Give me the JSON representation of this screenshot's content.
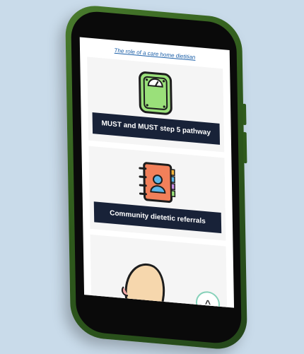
{
  "page": {
    "top_link": "The role of a care home dietitian",
    "cards": [
      {
        "label": "MUST and MUST step 5 pathway",
        "icon": "weighing-scale-icon"
      },
      {
        "label": "Community dietetic referrals",
        "icon": "address-book-icon"
      },
      {
        "label": "",
        "icon": "face-icon"
      }
    ],
    "scroll_top_icon": "chevron-up-icon",
    "scroll_top_glyph": "^"
  },
  "colors": {
    "background": "#c9dbea",
    "phone_frame": "#2f5a1c",
    "label_bg": "#182238",
    "link": "#1b5fa8",
    "scale_green": "#9ae07a",
    "book_orange": "#f2805a",
    "scroll_ring": "#86d1b9"
  }
}
